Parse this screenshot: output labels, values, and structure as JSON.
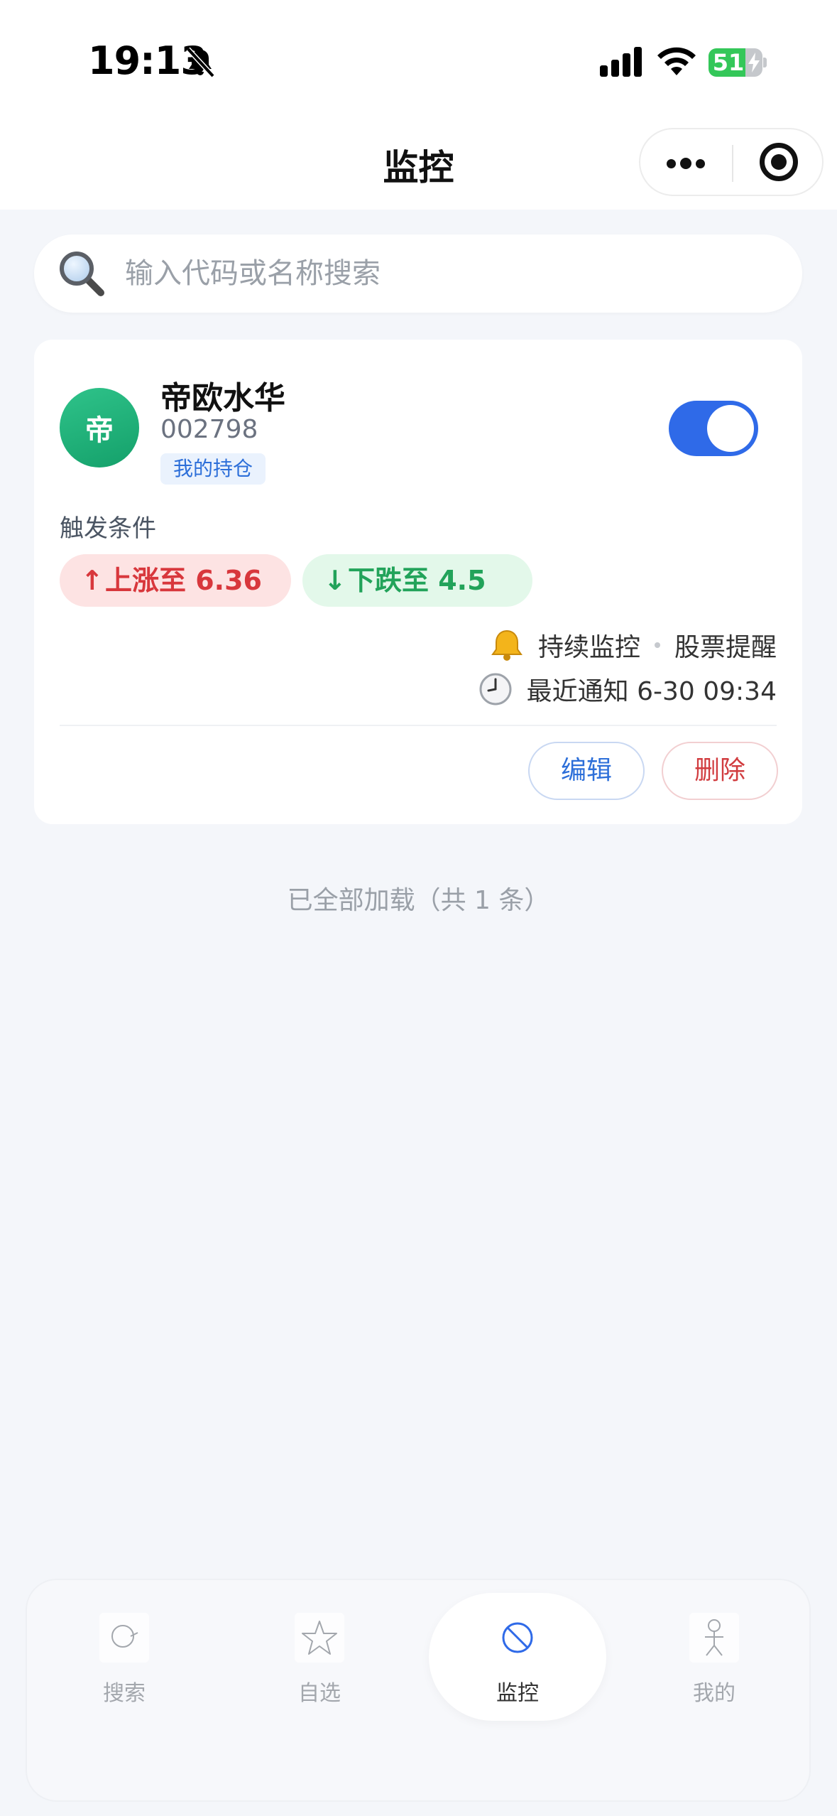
{
  "status_bar": {
    "time": "19:13",
    "battery_level": "51",
    "icons": [
      "bell-slash-icon",
      "signal-icon",
      "wifi-icon",
      "battery-charging-icon"
    ]
  },
  "nav": {
    "title": "监控",
    "icons": [
      "more-dots-icon",
      "close-target-icon"
    ]
  },
  "search": {
    "placeholder": "输入代码或名称搜索",
    "icon": "magnifier-icon"
  },
  "monitor_card": {
    "avatar_text": "帝",
    "stock_name": "帝欧水华",
    "stock_code": "002798",
    "tag": "我的持仓",
    "enabled": true,
    "conditions_label": "触发条件",
    "condition_up": "上涨至 6.36",
    "condition_down": "下跌至 4.5",
    "mode": "持续监控",
    "alert_type": "股票提醒",
    "last_notice": "最近通知 6-30 09:34",
    "edit_label": "编辑",
    "delete_label": "删除"
  },
  "list_footer": "已全部加载（共 1 条）",
  "tabbar": {
    "tabs": [
      {
        "label": "搜索",
        "icon": "search-tab-icon"
      },
      {
        "label": "自选",
        "icon": "star-tab-icon"
      },
      {
        "label": "监控",
        "icon": "monitor-tab-icon",
        "active": true
      },
      {
        "label": "我的",
        "icon": "person-tab-icon"
      }
    ]
  },
  "colors": {
    "accent_blue": "#2f6ae8",
    "up_red": "#d8373c",
    "down_green": "#22a35a",
    "avatar_green": "#1fb27a",
    "page_bg": "#f4f6fa"
  }
}
